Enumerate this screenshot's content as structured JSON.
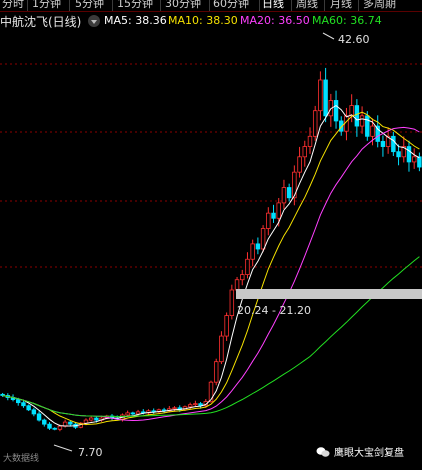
{
  "periods": [
    "分时",
    "1分钟",
    "5分钟",
    "15分钟",
    "30分钟",
    "60分钟",
    "日线",
    "周线",
    "月线",
    "多周期"
  ],
  "active_period": "日线",
  "stock_title": "中航沈飞(日线)",
  "ma": [
    {
      "label": "MA5: 38.36",
      "color": "#ffffff"
    },
    {
      "label": "MA10: 38.30",
      "color": "#f5e100"
    },
    {
      "label": "MA20: 36.50",
      "color": "#ff40ff"
    },
    {
      "label": "MA60: 36.74",
      "color": "#22e022"
    }
  ],
  "annotations": {
    "high": "42.60",
    "low": "7.70",
    "range_bar": "20.24 - 21.20"
  },
  "footer_logo": "大数据线",
  "watermark": "鹰眼大宝剑复盘",
  "colors": {
    "up": "#ff3030",
    "down": "#00e0ff",
    "grid": "#8b0000",
    "background": "#000000"
  },
  "icons": {
    "dropdown": "chevron-down-icon",
    "watermark": "wechat-icon",
    "logo": "app-logo-icon"
  },
  "chart_data": {
    "type": "candlestick",
    "x_label": "",
    "y_label": "",
    "ylim": [
      5,
      46
    ],
    "series": [
      {
        "name": "MA5",
        "color": "#ffffff"
      },
      {
        "name": "MA10",
        "color": "#f5e100"
      },
      {
        "name": "MA20",
        "color": "#ff40ff"
      },
      {
        "name": "MA60",
        "color": "#22e022"
      }
    ],
    "close": [
      11.2,
      11.0,
      10.8,
      10.5,
      10.2,
      9.8,
      9.4,
      8.8,
      8.4,
      8.0,
      7.9,
      8.2,
      8.6,
      8.4,
      8.1,
      8.5,
      8.8,
      9.0,
      8.8,
      9.0,
      9.2,
      9.0,
      8.9,
      9.3,
      9.5,
      9.4,
      9.6,
      9.5,
      9.7,
      9.6,
      9.8,
      9.7,
      9.9,
      10.0,
      9.8,
      10.1,
      10.3,
      10.4,
      10.2,
      10.6,
      12.5,
      14.5,
      17.0,
      19.0,
      21.5,
      22.5,
      23.0,
      24.5,
      26.0,
      25.5,
      27.5,
      29.0,
      28.5,
      30.0,
      31.5,
      30.5,
      33.0,
      34.5,
      35.5,
      36.5,
      39.0,
      42.0,
      38.5,
      40.0,
      38.0,
      37.0,
      38.5,
      39.5,
      37.5,
      38.5,
      36.5,
      37.5,
      36.0,
      35.5,
      36.5,
      35.0,
      34.5,
      35.5,
      34.0,
      34.5,
      33.5
    ]
  }
}
